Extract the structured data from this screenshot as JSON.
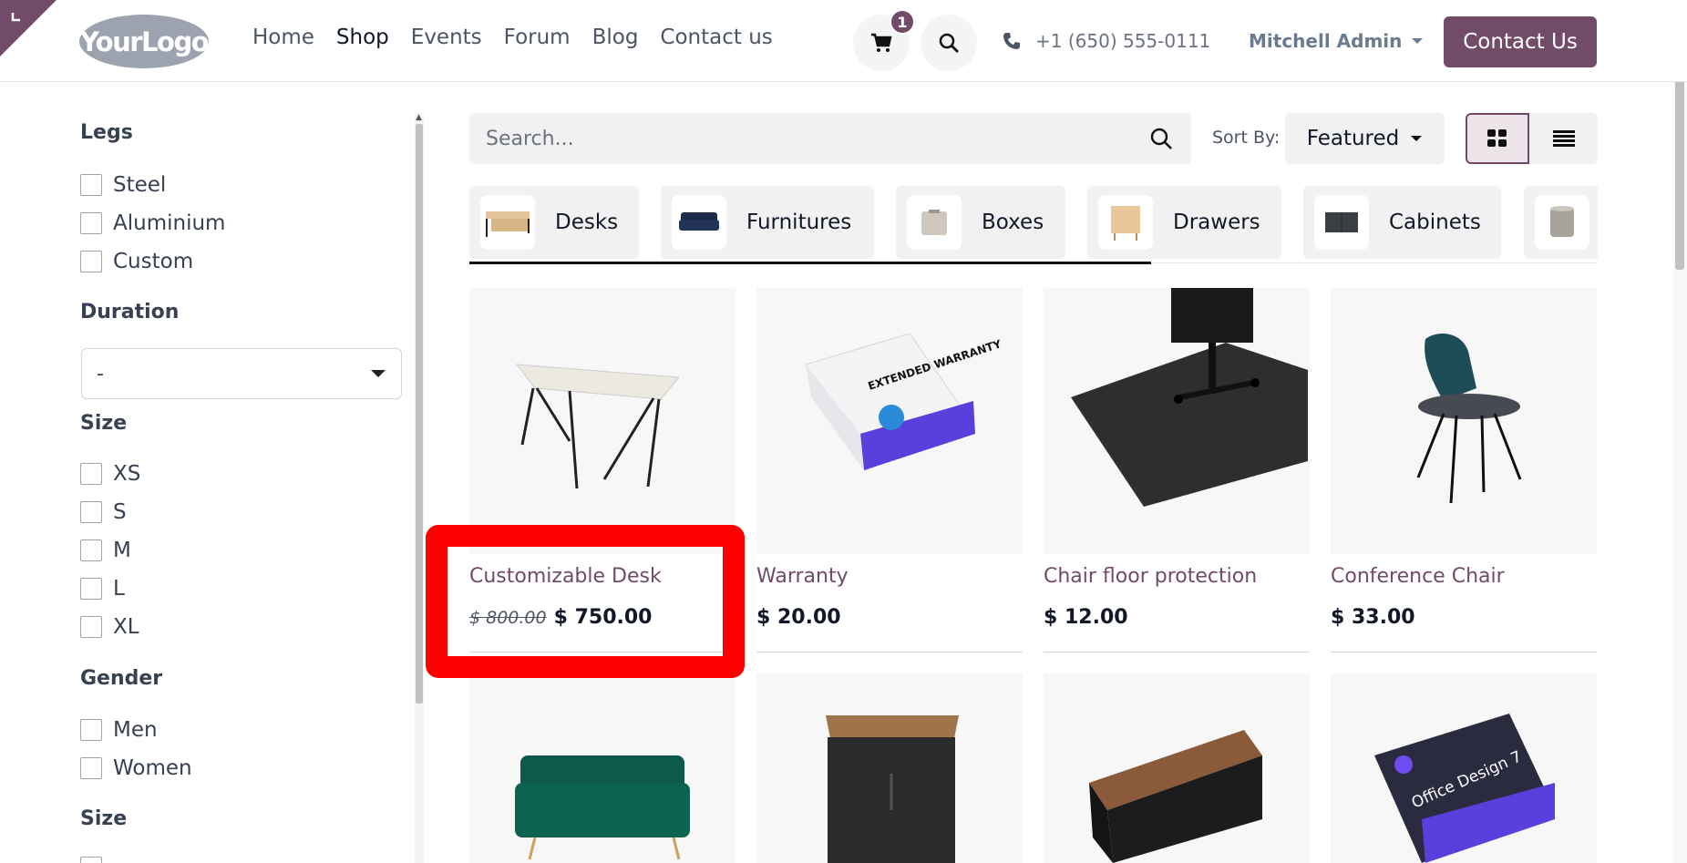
{
  "header": {
    "logo_text": "YourLogo",
    "nav": [
      {
        "label": "Home",
        "active": false
      },
      {
        "label": "Shop",
        "active": true
      },
      {
        "label": "Events",
        "active": false
      },
      {
        "label": "Forum",
        "active": false
      },
      {
        "label": "Blog",
        "active": false
      },
      {
        "label": "Contact us",
        "active": false
      }
    ],
    "cart_count": "1",
    "phone": "+1 (650) 555-0111",
    "user": "Mitchell Admin",
    "contact_button": "Contact Us",
    "accent_color": "#714B67"
  },
  "sidebar": {
    "legs": {
      "title": "Legs",
      "options": [
        "Steel",
        "Aluminium",
        "Custom"
      ]
    },
    "duration": {
      "title": "Duration",
      "selected": "-"
    },
    "size": {
      "title": "Size",
      "options": [
        "XS",
        "S",
        "M",
        "L",
        "XL"
      ]
    },
    "gender": {
      "title": "Gender",
      "options": [
        "Men",
        "Women"
      ]
    },
    "size2": {
      "title": "Size"
    }
  },
  "toolbar": {
    "search_placeholder": "Search...",
    "sort_label": "Sort By:",
    "sort_value": "Featured"
  },
  "categories": [
    "Desks",
    "Furnitures",
    "Boxes",
    "Drawers",
    "Cabinets",
    ""
  ],
  "products": [
    {
      "name": "Customizable Desk",
      "old_price": "$ 800.00",
      "price": "$ 750.00"
    },
    {
      "name": "Warranty",
      "price": "$ 20.00"
    },
    {
      "name": "Chair floor protection",
      "price": "$ 12.00"
    },
    {
      "name": "Conference Chair",
      "price": "$ 33.00"
    }
  ],
  "warranty_box_text": "EXTENDED WARRANTY",
  "office_box_text": "Office Design 7"
}
